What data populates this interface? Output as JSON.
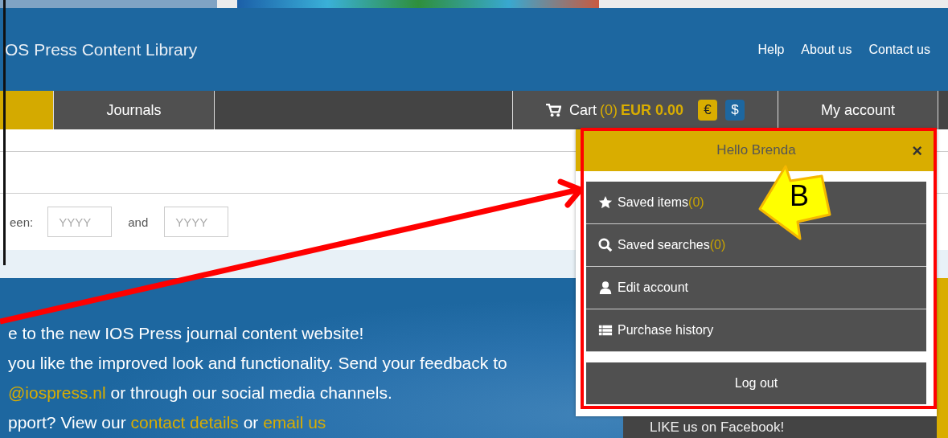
{
  "header": {
    "logo": "OS Press Content Library",
    "links": [
      "Help",
      "About us",
      "Contact us"
    ]
  },
  "nav": {
    "tabs": [
      {
        "selected": true
      },
      {
        "label": "Journals",
        "selected": false
      }
    ],
    "cart": {
      "label": "Cart",
      "count": "(0)",
      "total": "EUR 0.00",
      "currencies": [
        {
          "symbol": "€",
          "selected": true
        },
        {
          "symbol": "$",
          "selected": false
        }
      ]
    },
    "account": "My account"
  },
  "search": {
    "date_label": "een:",
    "from": {
      "placeholder": "YYYY"
    },
    "joiner": "and",
    "to": {
      "placeholder": "YYYY"
    }
  },
  "welcome": {
    "lines": [
      [
        {
          "text": "e to the new IOS Press journal content website!",
          "kind": "text"
        }
      ],
      [
        {
          "text": "you like the improved look and functionality. Send your feedback to",
          "kind": "text"
        }
      ],
      [
        {
          "text": "@iospress.nl",
          "kind": "link"
        },
        {
          "text": " or through our social media channels.",
          "kind": "text"
        }
      ],
      [
        {
          "text": "pport? View our ",
          "kind": "text"
        },
        {
          "text": "contact details",
          "kind": "link"
        },
        {
          "text": " or ",
          "kind": "text"
        },
        {
          "text": "email us",
          "kind": "link"
        }
      ]
    ]
  },
  "facebook": "LIKE us on Facebook!",
  "dropdown": {
    "greeting": "Hello Brenda",
    "close": "×",
    "items": [
      {
        "kind": "star",
        "label": "Saved items",
        "count": "(0)"
      },
      {
        "kind": "search",
        "label": "Saved searches",
        "count": "(0)"
      },
      {
        "kind": "user",
        "label": "Edit account"
      },
      {
        "kind": "list",
        "label": "Purchase history"
      }
    ],
    "logout": "Log out"
  },
  "annotation": {
    "callout": "B"
  }
}
